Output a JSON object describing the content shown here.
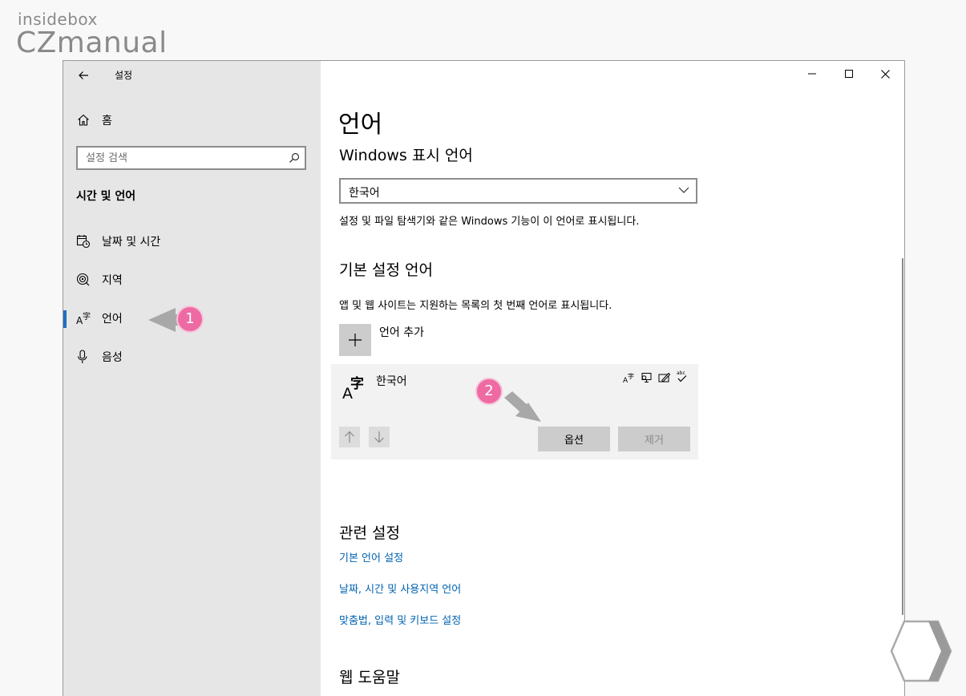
{
  "brand": {
    "top": "insidebox",
    "main": "CZmanual"
  },
  "window": {
    "title": "설정",
    "controls": [
      "minimize",
      "maximize",
      "close"
    ]
  },
  "sidebar": {
    "home_label": "홈",
    "search_placeholder": "설정 검색",
    "section_title": "시간 및 언어",
    "items": [
      {
        "label": "날짜 및 시간",
        "icon": "calendar-clock-icon",
        "active": false
      },
      {
        "label": "지역",
        "icon": "globe-region-icon",
        "active": false
      },
      {
        "label": "언어",
        "icon": "language-icon",
        "active": true
      },
      {
        "label": "음성",
        "icon": "microphone-icon",
        "active": false
      }
    ]
  },
  "main": {
    "page_title": "언어",
    "display_language": {
      "heading": "Windows 표시 언어",
      "selected": "한국어",
      "description": "설정 및 파일 탐색기와 같은 Windows 기능이 이 언어로 표시됩니다."
    },
    "preferred_languages": {
      "heading": "기본 설정 언어",
      "description": "앱 및 웹 사이트는 지원하는 목록의 첫 번째 언어로 표시됩니다.",
      "add_label": "언어 추가",
      "languages": [
        {
          "name": "한국어",
          "feature_icons": [
            "display-language-icon",
            "speech-icon",
            "handwriting-icon",
            "spellcheck-icon"
          ],
          "options_label": "옵션",
          "remove_label": "제거"
        }
      ]
    },
    "related": {
      "heading": "관련 설정",
      "links": [
        "기본 언어 설정",
        "날짜, 시간 및 사용지역 언어",
        "맞춤법, 입력 및 키보드 설정"
      ]
    },
    "web_help_heading": "웹 도움말"
  },
  "callouts": [
    "1",
    "2"
  ],
  "colors": {
    "accent": "#1f6fbf",
    "link": "#0063b1",
    "sidebar_bg": "#e6e6e6",
    "callout": "#ee6aa3"
  }
}
